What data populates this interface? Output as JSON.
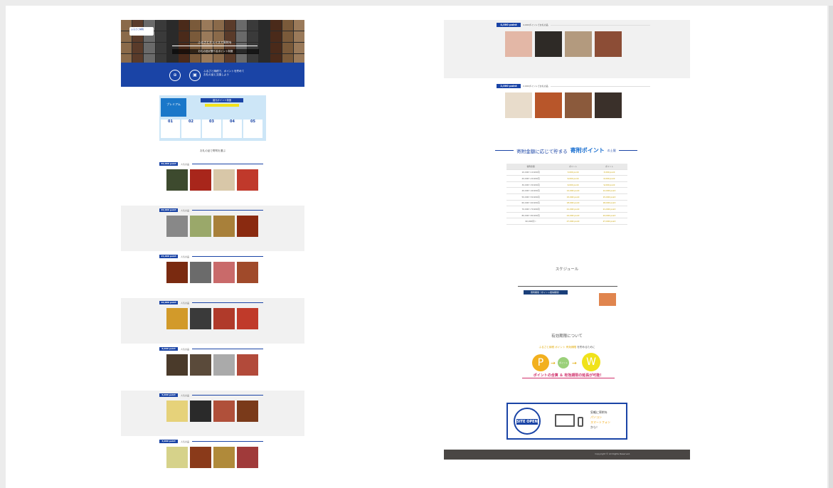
{
  "left_page": {
    "hero": {
      "logo_text": "ふるさと納税",
      "caption_1": "ふるさとチョイスで寄附を",
      "caption_2": "お礼の品が選べるポイント制度",
      "band_text": "ふるさと納税で、ポイントを貯めてお礼の品と交換しよう",
      "step_1_icon": "⊕",
      "step_2_icon": "▣"
    },
    "premium": {
      "left_label": "プレミアム",
      "top_label": "還元ポイント制度",
      "steps": [
        "01",
        "02",
        "03",
        "04",
        "05"
      ]
    },
    "section_title": "お礼の品で寄附を選ぶ",
    "categories": [
      {
        "tag": "30,000 point",
        "caption": "人気の品",
        "gray": false
      },
      {
        "tag": "20,000 point",
        "caption": "人気の品",
        "gray": true
      },
      {
        "tag": "15,000 point",
        "caption": "人気の品",
        "gray": false
      },
      {
        "tag": "10,000 point",
        "caption": "人気の品",
        "gray": true
      },
      {
        "tag": "8,000 point",
        "caption": "人気の品",
        "gray": false
      },
      {
        "tag": "5,000 point",
        "caption": "人気の品",
        "gray": true
      },
      {
        "tag": "3,000 point",
        "caption": "人気の品",
        "gray": false
      }
    ]
  },
  "right_page": {
    "section_4000": {
      "tag": "4,000 point",
      "label": "4,000ポイントでお礼の品"
    },
    "section_2000": {
      "tag": "2,000 point",
      "label": "2,000ポイントでお礼の品"
    },
    "points_title": {
      "prefix": "寄附金額に応じて貯まる",
      "highlight": "寄附ポイント",
      "suffix": "の上限"
    },
    "points_table": {
      "headers": [
        "寄附金額",
        "ポイント",
        "ポイント"
      ],
      "rows": [
        [
          "10,000〜19,999円",
          "3,000 point",
          "3,000 point"
        ],
        [
          "20,000〜29,999円",
          "6,000 point",
          "6,000 point"
        ],
        [
          "30,000〜39,999円",
          "9,000 point",
          "9,000 point"
        ],
        [
          "40,000〜49,999円",
          "12,000 point",
          "12,000 point"
        ],
        [
          "50,000〜59,999円",
          "15,000 point",
          "15,000 point"
        ],
        [
          "60,000〜69,999円",
          "18,000 point",
          "18,000 point"
        ],
        [
          "70,000〜79,999円",
          "21,000 point",
          "21,000 point"
        ],
        [
          "80,000〜89,999円",
          "24,000 point",
          "24,000 point"
        ],
        [
          "90,000円〜",
          "27,000 point",
          "27,000 point"
        ]
      ]
    },
    "schedule": {
      "title": "スケジュール",
      "bar_label": "寄附期間（ポイント獲得期間）"
    },
    "point_merge": {
      "title": "有効期限について",
      "sub_prefix": "ふるさと納税 ポイント ",
      "sub_highlight": "有効期限",
      "sub_suffix": " を貯めるために",
      "coin_p": "P",
      "coin_g": "ポイント",
      "coin_w": "W",
      "caption": "ポイントの合算 ＆ 有効期限の延長が可能！"
    },
    "open_banner": {
      "badge": "SITE OPEN",
      "line_1": "気軽に寄附を",
      "line_2": "パソコン",
      "line_3": "スマートフォン",
      "line_4": "から！"
    },
    "footer": "Copyright © All Rights Reserved."
  }
}
